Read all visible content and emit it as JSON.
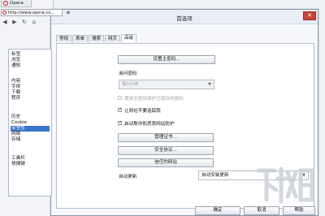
{
  "browser": {
    "tab_label": "Opera",
    "url": "http://www.opera.co...",
    "nav": {
      "back": "◀",
      "forward": "▶",
      "reload": "↻",
      "home": "⌂"
    }
  },
  "dialog": {
    "title": "首选项",
    "close_label": "✕",
    "tabs": [
      {
        "label": "常规"
      },
      {
        "label": "表单"
      },
      {
        "label": "搜索"
      },
      {
        "label": "网页"
      },
      {
        "label": "高级"
      }
    ],
    "categories": [
      "标签",
      "浏览",
      "通知",
      "内容",
      "字体",
      "下载",
      "程序",
      "历史",
      "Cookie",
      "安全性",
      "网络",
      "存储",
      "工具栏",
      "快捷键"
    ],
    "selected_category": "安全性",
    "master_password_button": "设置主密码...",
    "ask_password_label": "询问密码",
    "ask_password_value": "每5分钟",
    "use_master_password_label": "使用主密码保护已保存的密码",
    "fraud_warning_label": "让网址不要追踪我",
    "fraud_protection_label": "启动欺诈和恶意网站防护",
    "manage_certificates_button": "管理证书...",
    "security_protocols_button": "安全协议...",
    "trusted_websites_button": "信任的网站",
    "auto_update_label": "自动更新",
    "auto_update_value": "自动安装更新",
    "ok_button": "确定",
    "cancel_button": "取消",
    "help_button": "帮助"
  },
  "watermark_text": "下载吧",
  "colors": {
    "selection": "#3b76c8",
    "opera_red": "#d1111b",
    "close_red": "#c7453a"
  }
}
